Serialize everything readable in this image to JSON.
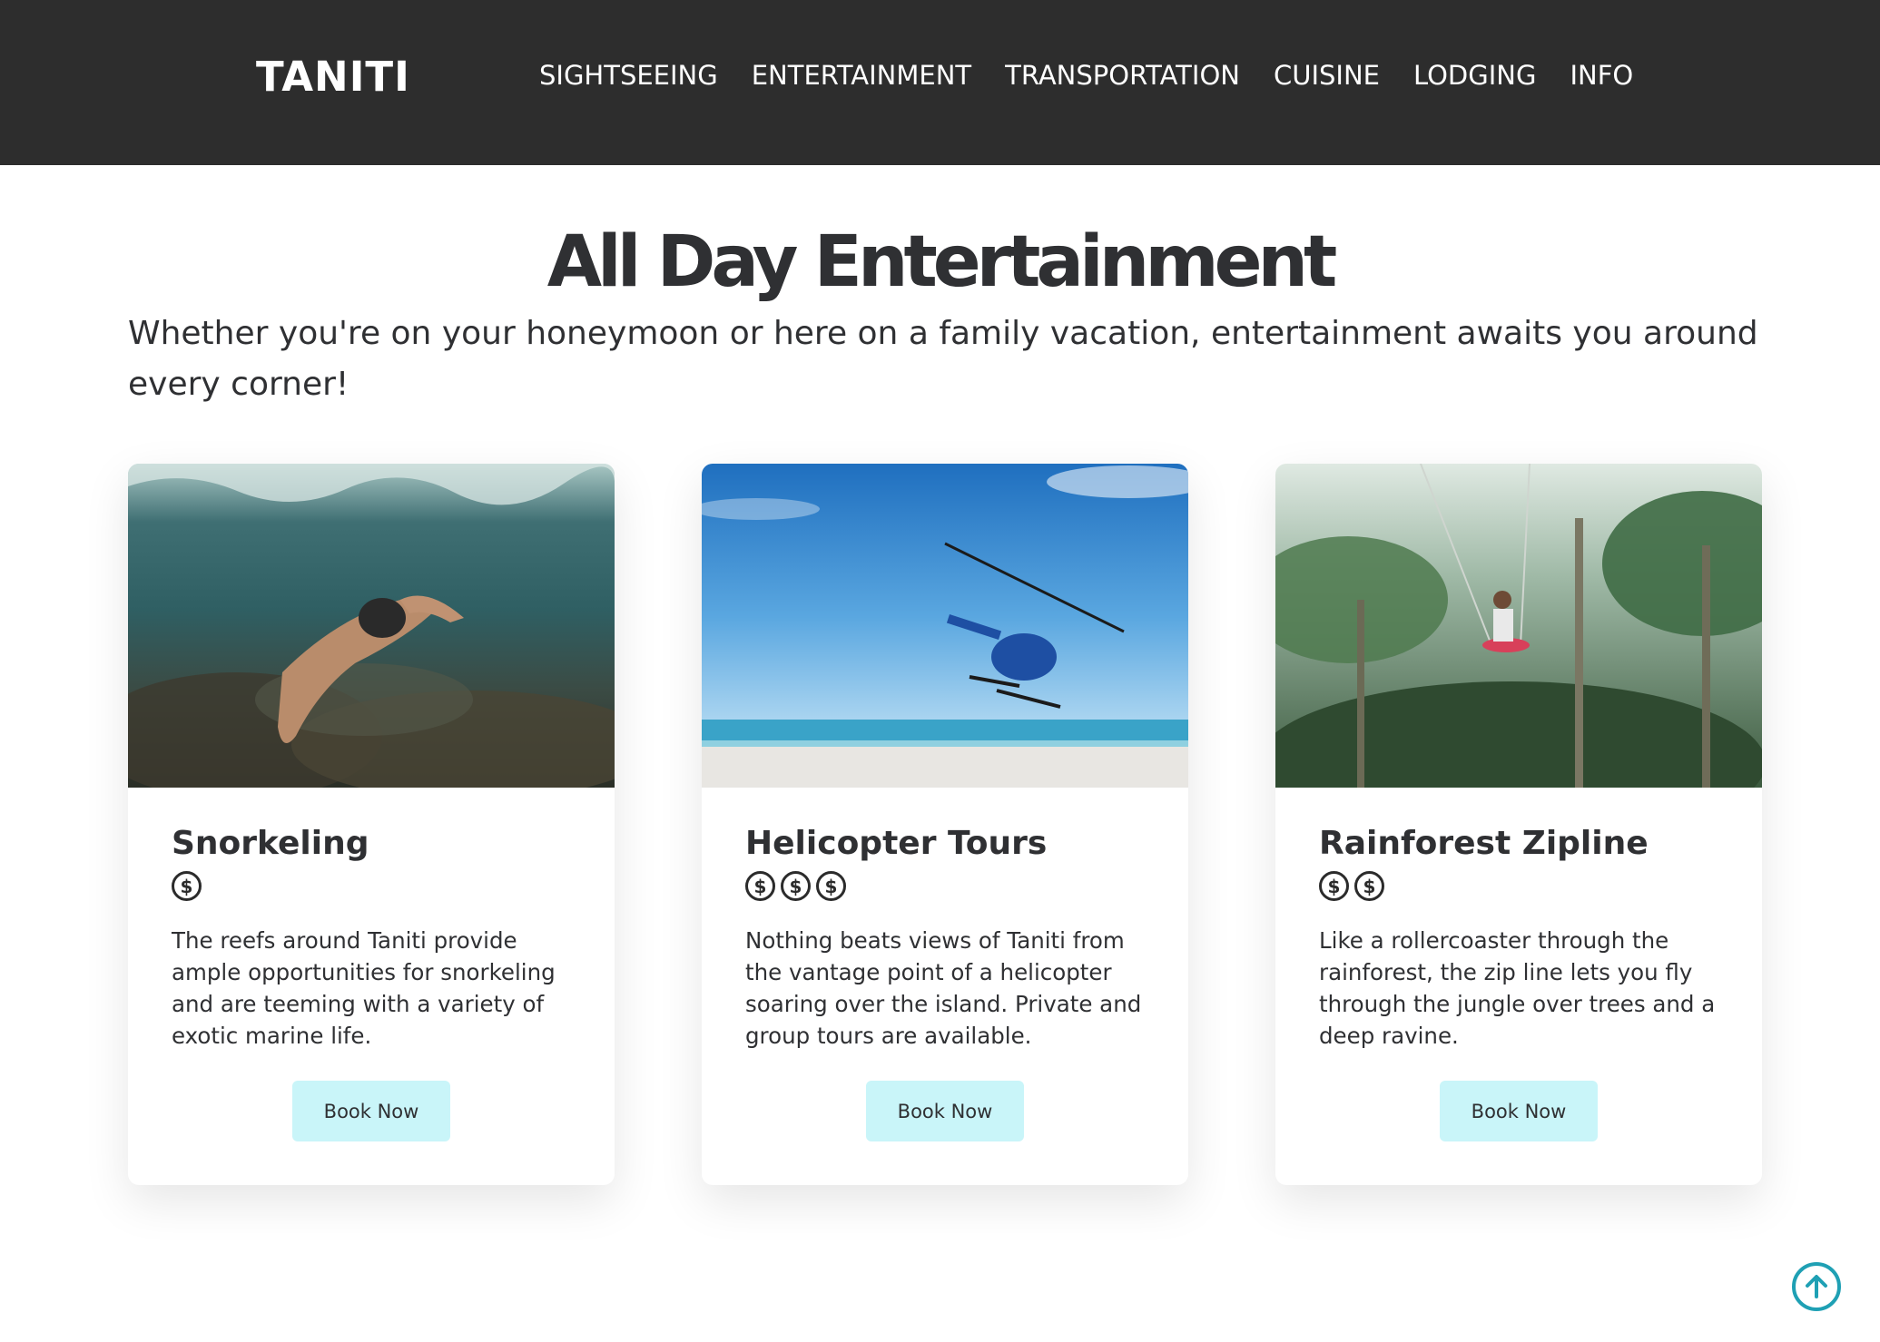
{
  "header": {
    "brand": "TANITI",
    "nav": [
      "SIGHTSEEING",
      "ENTERTAINMENT",
      "TRANSPORTATION",
      "CUISINE",
      "LODGING",
      "INFO"
    ]
  },
  "hero": {
    "title": "All Day Entertainment",
    "intro": "Whether you're on your honeymoon or here on a family vacation, entertainment awaits you around every corner!"
  },
  "cards": [
    {
      "title": "Snorkeling",
      "price_level": 1,
      "description": "The reefs around Taniti provide ample opportunities for snorkeling and are teeming with a variety of exotic marine life.",
      "button": "Book Now"
    },
    {
      "title": "Helicopter Tours",
      "price_level": 3,
      "description": "Nothing beats views of Taniti from the vantage point of a helicopter soaring over the island. Private and group tours are available.",
      "button": "Book Now"
    },
    {
      "title": "Rainforest Zipline",
      "price_level": 2,
      "description": "Like a rollercoaster through the rainforest, the zip line lets you fly through the jungle over trees and a deep ravine.",
      "button": "Book Now"
    }
  ],
  "icons": {
    "price": "dollar-circle-icon",
    "back_to_top": "arrow-up-circle-icon"
  },
  "colors": {
    "header_bg": "#2d2d2d",
    "button_bg": "#c9f5f9",
    "accent": "#1fa0b4",
    "text": "#2f3033"
  }
}
